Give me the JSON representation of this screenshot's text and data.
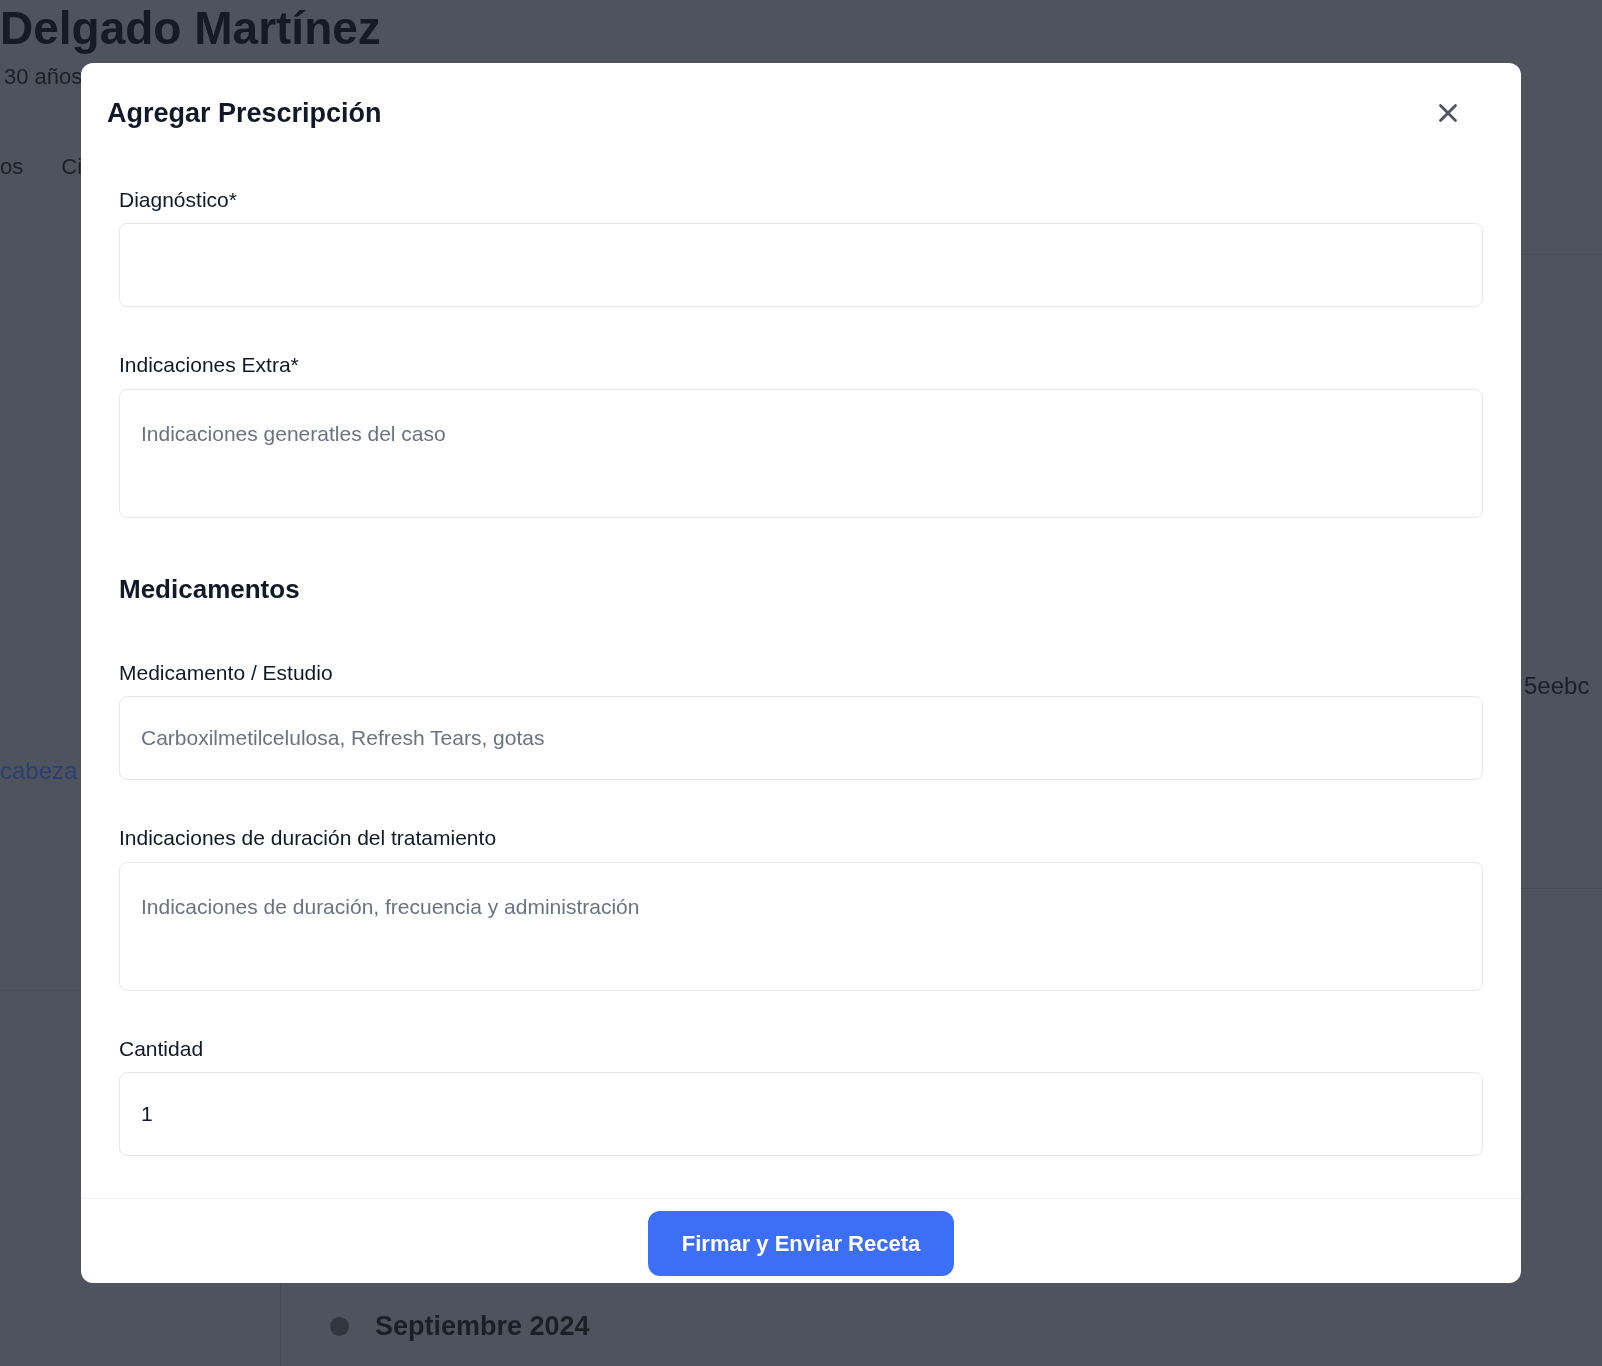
{
  "background": {
    "patient_name": "Delgado Martínez",
    "patient_age": "30 años",
    "tabs": [
      "os",
      "Ci"
    ],
    "link": "cabeza",
    "id_fragment": "5eebc",
    "timeline": [
      {
        "label": "Septiembre 2024"
      }
    ]
  },
  "modal": {
    "title": "Agregar Prescripción",
    "items": [
      {
        "kind": "input",
        "label": "Diagnóstico*"
      },
      {
        "kind": "textarea",
        "label": "Indicaciones Extra*",
        "placeholder": "Indicaciones generatles del caso"
      },
      {
        "kind": "heading",
        "label": "Medicamentos"
      },
      {
        "kind": "input",
        "label": "Medicamento / Estudio",
        "placeholder": "Carboxilmetilcelulosa, Refresh Tears, gotas"
      },
      {
        "kind": "textarea",
        "label": "Indicaciones de duración del tratamiento",
        "placeholder": "Indicaciones de duración, frecuencia y administración"
      },
      {
        "kind": "input",
        "label": "Cantidad",
        "value": "1"
      }
    ],
    "submit": "Firmar y Enviar Receta"
  }
}
